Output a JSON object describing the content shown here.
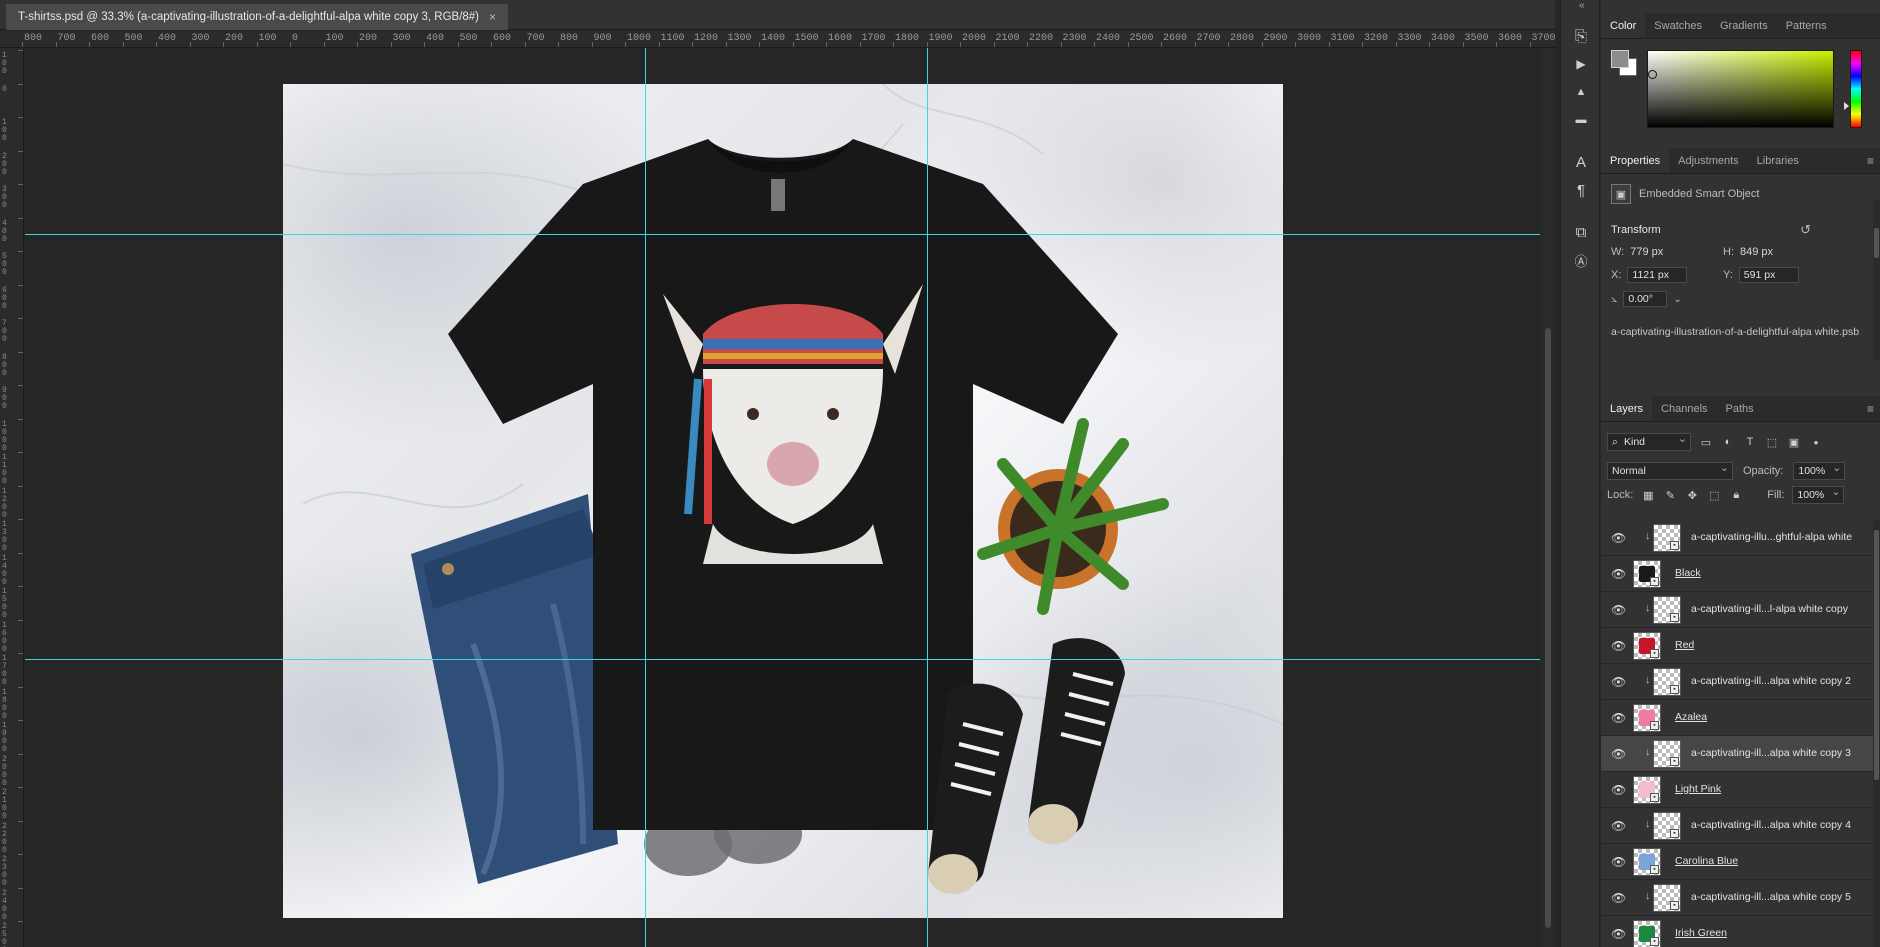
{
  "document": {
    "tab_title": "T-shirtss.psd @ 33.3% (a-captivating-illustration-of-a-delightful-alpa white copy 3, RGB/8#)",
    "close_glyph": "×"
  },
  "ruler": {
    "h_labels": [
      "800",
      "700",
      "600",
      "500",
      "400",
      "300",
      "200",
      "100",
      "0",
      "100",
      "200",
      "300",
      "400",
      "500",
      "600",
      "700",
      "800",
      "900",
      "1000",
      "1100",
      "1200",
      "1300",
      "1400",
      "1500",
      "1600",
      "1700",
      "1800",
      "1900",
      "2000",
      "2100",
      "2200",
      "2300",
      "2400",
      "2500",
      "2600",
      "2700",
      "2800",
      "2900",
      "3000",
      "3100",
      "3200",
      "3300",
      "3400",
      "3500",
      "3600",
      "3700"
    ],
    "v_labels": [
      "100",
      "0",
      "100",
      "200",
      "300",
      "400",
      "500",
      "600",
      "700",
      "800",
      "900",
      "1000",
      "1100",
      "1200",
      "1300",
      "1400",
      "1500",
      "1600",
      "1700",
      "1800",
      "1900",
      "2000",
      "2100",
      "2200",
      "2300",
      "2400",
      "2500"
    ]
  },
  "icons": {
    "collapse": "«",
    "tools": [
      {
        "name": "history-icon",
        "glyph": "⎘"
      },
      {
        "name": "play-icon",
        "glyph": "▶"
      },
      {
        "name": "stamp-icon",
        "glyph": "▲"
      },
      {
        "name": "comment-icon",
        "glyph": "▬"
      },
      {
        "name": "character-icon",
        "glyph": "A"
      },
      {
        "name": "paragraph-icon",
        "glyph": "¶"
      },
      {
        "name": "copy-icon",
        "glyph": "⧉"
      },
      {
        "name": "glyphs-icon",
        "glyph": "Ⓐ"
      }
    ]
  },
  "color_panel": {
    "tabs": [
      "Color",
      "Swatches",
      "Gradients",
      "Patterns"
    ],
    "menu_glyph": "≡"
  },
  "properties_panel": {
    "tabs": [
      "Properties",
      "Adjustments",
      "Libraries"
    ],
    "menu_glyph": "≡",
    "object_type": "Embedded Smart Object",
    "transform_label": "Transform",
    "reset_glyph": "↺",
    "w_label": "W:",
    "w_value": "779 px",
    "h_label": "H:",
    "h_value": "849 px",
    "x_label": "X:",
    "x_value": "1121 px",
    "y_label": "Y:",
    "y_value": "591 px",
    "angle_glyph": "⦣",
    "angle_value": "0.00°",
    "filename": "a-captivating-illustration-of-a-delightful-alpa white.psb"
  },
  "layers_panel": {
    "tabs": [
      "Layers",
      "Channels",
      "Paths"
    ],
    "menu_glyph": "≡",
    "filter_kind": "Kind",
    "blend_mode": "Normal",
    "opacity_label": "Opacity:",
    "opacity_value": "100%",
    "lock_label": "Lock:",
    "fill_label": "Fill:",
    "fill_value": "100%",
    "layers": [
      {
        "name": "a-captivating-illu...ghtful-alpa white",
        "clipped": true,
        "color": "",
        "selected": false
      },
      {
        "name": "Black",
        "clipped": false,
        "color": "#1a1a1a",
        "selected": false
      },
      {
        "name": "a-captivating-ill...l-alpa white copy",
        "clipped": true,
        "color": "",
        "selected": false
      },
      {
        "name": "Red",
        "clipped": false,
        "color": "#c4182a",
        "selected": false
      },
      {
        "name": "a-captivating-ill...alpa white copy 2",
        "clipped": true,
        "color": "",
        "selected": false
      },
      {
        "name": "Azalea",
        "clipped": false,
        "color": "#f07aa8",
        "selected": false
      },
      {
        "name": "a-captivating-ill...alpa white copy 3",
        "clipped": true,
        "color": "",
        "selected": true
      },
      {
        "name": "Light Pink",
        "clipped": false,
        "color": "#f4bcd0",
        "selected": false
      },
      {
        "name": "a-captivating-ill...alpa white copy 4",
        "clipped": true,
        "color": "",
        "selected": false
      },
      {
        "name": "Carolina Blue",
        "clipped": false,
        "color": "#7ea3db",
        "selected": false
      },
      {
        "name": "a-captivating-ill...alpa white copy 5",
        "clipped": true,
        "color": "",
        "selected": false
      },
      {
        "name": "Irish Green",
        "clipped": false,
        "color": "#1c8a3e",
        "selected": false
      }
    ]
  }
}
